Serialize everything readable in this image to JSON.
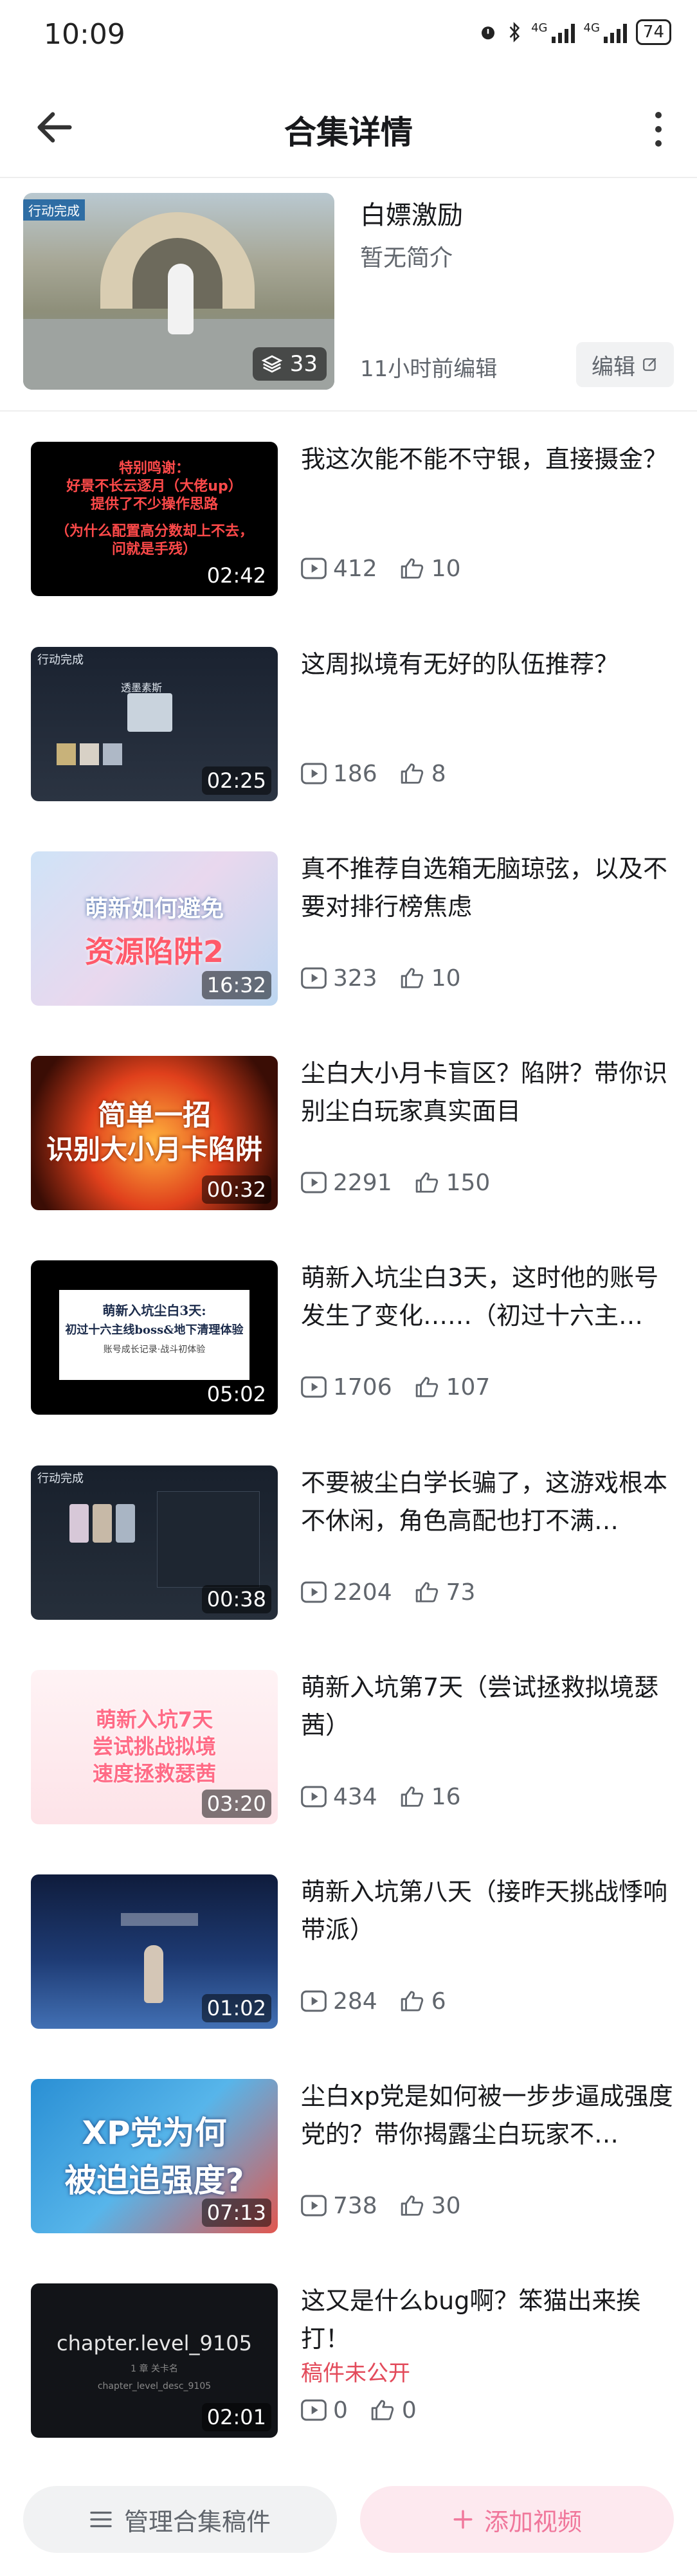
{
  "status_bar": {
    "time": "10:09",
    "signal1": "4G",
    "signal2": "4G",
    "battery": "74"
  },
  "header": {
    "title": "合集详情"
  },
  "collection": {
    "cover_tag": "行动完成",
    "count": "33",
    "title": "白嫖激励",
    "description": "暂无简介",
    "edited": "11小时前编辑",
    "edit_label": "编辑"
  },
  "videos": [
    {
      "title": "我这次能不能不守银，直接摄金？",
      "duration": "02:42",
      "views": "412",
      "likes": "10",
      "status": "",
      "caption": [
        "特别鸣谢：",
        "好景不长云逐月（大佬up）",
        "提供了不少操作思路",
        "（为什么配置高分数却上不去，",
        "问就是手残）"
      ]
    },
    {
      "title": "这周拟境有无好的队伍推荐？",
      "duration": "02:25",
      "views": "186",
      "likes": "8",
      "status": "",
      "caption": [
        "行动完成",
        "透墨素斯"
      ]
    },
    {
      "title": "真不推荐自选箱无脑琼弦，以及不要对排行榜焦虑",
      "duration": "16:32",
      "views": "323",
      "likes": "10",
      "status": "",
      "caption": [
        "萌新如何避免",
        "资源陷阱2"
      ]
    },
    {
      "title": "尘白大小月卡盲区？陷阱？带你识别尘白玩家真实面目",
      "duration": "00:32",
      "views": "2291",
      "likes": "150",
      "status": "",
      "caption": [
        "简单一招",
        "识别大小月卡陷阱"
      ]
    },
    {
      "title": "萌新入坑尘白3天，这时他的账号发生了变化……（初过十六主…",
      "duration": "05:02",
      "views": "1706",
      "likes": "107",
      "status": "",
      "caption": [
        "萌新入坑尘白3天:",
        "初过十六主线boss&地下清理体验",
        "账号成长记录·战斗初体验"
      ]
    },
    {
      "title": "不要被尘白学长骗了，这游戏根本不休闲，角色高配也打不满…",
      "duration": "00:38",
      "views": "2204",
      "likes": "73",
      "status": "",
      "caption": [
        "行动完成"
      ]
    },
    {
      "title": "萌新入坑第7天（尝试拯救拟境瑟茜）",
      "duration": "03:20",
      "views": "434",
      "likes": "16",
      "status": "",
      "caption": [
        "萌新入坑7天",
        "尝试挑战拟境",
        "速度拯救瑟茜"
      ]
    },
    {
      "title": "萌新入坑第八天（接昨天挑战悸响带派）",
      "duration": "01:02",
      "views": "284",
      "likes": "6",
      "status": "",
      "caption": []
    },
    {
      "title": "尘白xp党是如何被一步步逼成强度党的？带你揭露尘白玩家不…",
      "duration": "07:13",
      "views": "738",
      "likes": "30",
      "status": "",
      "caption": [
        "XP党为何",
        "被迫追强度?"
      ]
    },
    {
      "title": "这又是什么bug啊？笨猫出来挨打！",
      "duration": "02:01",
      "views": "0",
      "likes": "0",
      "status": "稿件未公开",
      "caption": [
        "chapter.level_9105",
        "1 章 关卡名",
        "chapter_level_desc_9105"
      ]
    }
  ],
  "bottom": {
    "manage_label": "管理合集稿件",
    "add_label": "添加视频"
  },
  "colors": {
    "accent_pink": "#f0779b",
    "add_bg": "#fde9ef",
    "muted": "#61666d",
    "unpublished": "#e34b5b"
  },
  "icons": {
    "back": "arrow-left-icon",
    "more": "more-vertical-icon",
    "stack": "layers-icon",
    "edit": "edit-icon",
    "play": "play-icon",
    "like": "thumb-up-icon",
    "manage": "list-icon",
    "add": "plus-icon"
  }
}
